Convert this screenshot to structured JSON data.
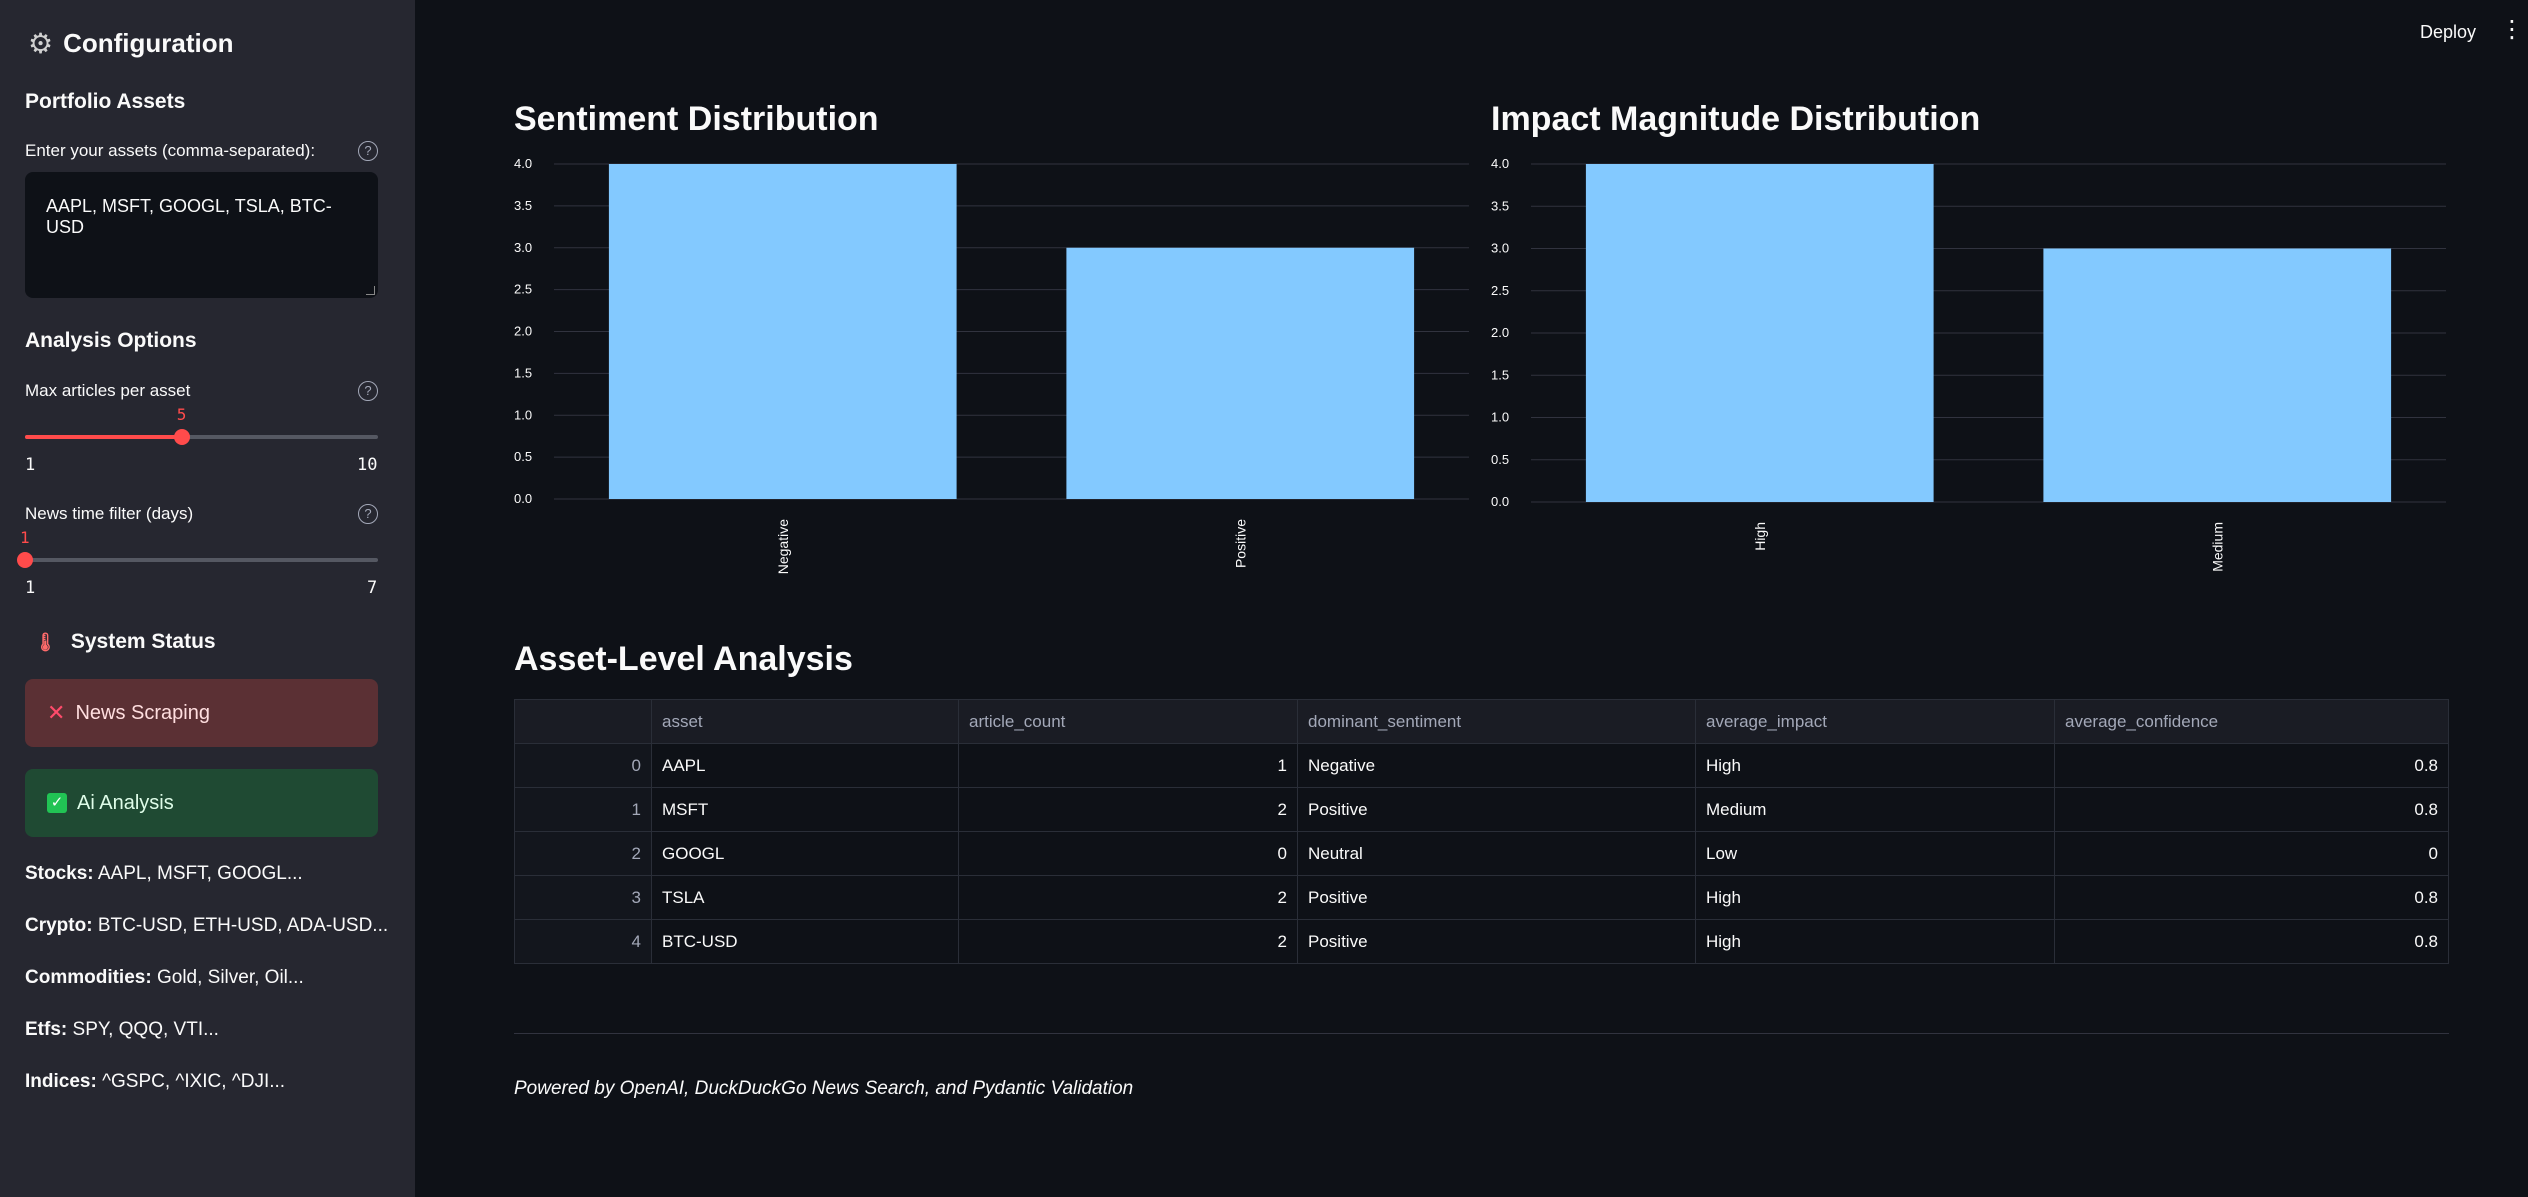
{
  "sidebar": {
    "title": "Configuration",
    "portfolio_heading": "Portfolio Assets",
    "assets_label": "Enter your assets (comma-separated):",
    "assets_value": "AAPL, MSFT, GOOGL, TSLA, BTC-USD",
    "analysis_heading": "Analysis Options",
    "max_articles": {
      "label": "Max articles per asset",
      "value": "5",
      "min": "1",
      "max": "10",
      "fraction": 0.444
    },
    "time_filter": {
      "label": "News time filter (days)",
      "value": "1",
      "min": "1",
      "max": "7",
      "fraction": 0.0
    },
    "status_heading": "System Status",
    "status_items": [
      {
        "label": "News Scraping",
        "state": "error"
      },
      {
        "label": "Ai Analysis",
        "state": "ok"
      }
    ],
    "categories": [
      {
        "name": "Stocks:",
        "value": "AAPL, MSFT, GOOGL..."
      },
      {
        "name": "Crypto:",
        "value": "BTC-USD, ETH-USD, ADA-USD..."
      },
      {
        "name": "Commodities:",
        "value": "Gold, Silver, Oil..."
      },
      {
        "name": "Etfs:",
        "value": "SPY, QQQ, VTI..."
      },
      {
        "name": "Indices:",
        "value": "^GSPC, ^IXIC, ^DJI..."
      }
    ]
  },
  "topbar": {
    "deploy_label": "Deploy"
  },
  "chart_data": [
    {
      "type": "bar",
      "title": "Sentiment Distribution",
      "categories": [
        "Negative",
        "Positive"
      ],
      "values": [
        4,
        3
      ],
      "yticks": [
        "0.0",
        "0.5",
        "1.0",
        "1.5",
        "2.0",
        "2.5",
        "3.0",
        "3.5",
        "4.0"
      ],
      "ylim": [
        0,
        4
      ],
      "grid": true,
      "color": "#83c9ff"
    },
    {
      "type": "bar",
      "title": "Impact Magnitude Distribution",
      "categories": [
        "High",
        "Medium"
      ],
      "values": [
        4,
        3
      ],
      "yticks": [
        "0.0",
        "0.5",
        "1.0",
        "1.5",
        "2.0",
        "2.5",
        "3.0",
        "3.5",
        "4.0"
      ],
      "ylim": [
        0,
        4
      ],
      "grid": true,
      "color": "#83c9ff"
    }
  ],
  "asset_section": {
    "title": "Asset-Level Analysis",
    "columns": [
      "",
      "asset",
      "article_count",
      "dominant_sentiment",
      "average_impact",
      "average_confidence"
    ],
    "rows": [
      [
        "0",
        "AAPL",
        "1",
        "Negative",
        "High",
        "0.8"
      ],
      [
        "1",
        "MSFT",
        "2",
        "Positive",
        "Medium",
        "0.8"
      ],
      [
        "2",
        "GOOGL",
        "0",
        "Neutral",
        "Low",
        "0"
      ],
      [
        "3",
        "TSLA",
        "2",
        "Positive",
        "High",
        "0.8"
      ],
      [
        "4",
        "BTC-USD",
        "2",
        "Positive",
        "High",
        "0.8"
      ]
    ]
  },
  "footer": "Powered by OpenAI, DuckDuckGo News Search, and Pydantic Validation"
}
